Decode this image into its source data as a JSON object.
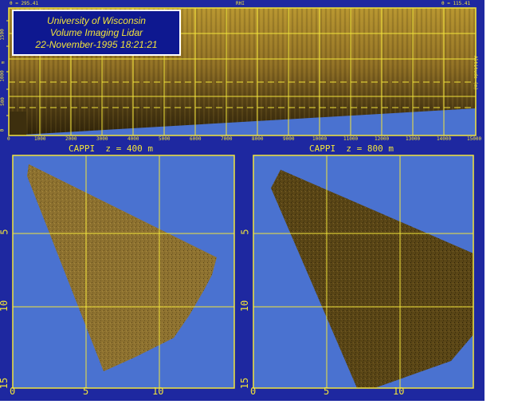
{
  "colors": {
    "frame": "#1e28a0",
    "sky": "#4a72d0",
    "grid": "#f2e43a",
    "lidar": "#8a6a22",
    "title_box": "#0e1890",
    "title_text": "#f2e43a"
  },
  "rhi": {
    "top_left": "θ = 295.41",
    "top_center": "RHI",
    "top_right": "θ = 115.41",
    "y_ticks": [
      "0",
      "500",
      "1000",
      "1500"
    ],
    "y_unit": "m",
    "right_label": "Altitude (m)",
    "x_ticks": [
      "0",
      "1000",
      "2000",
      "3000",
      "4000",
      "5000",
      "6000",
      "7000",
      "8000",
      "9000",
      "10000",
      "11000",
      "12000",
      "13000",
      "14000",
      "15000"
    ]
  },
  "title_box": {
    "line1": "University of Wisconsin",
    "line2": "Volume Imaging Lidar",
    "line3": "22-November-1995 18:21:21"
  },
  "cappi_left": {
    "title": "CAPPI  z = 400 m",
    "y_ticks": [
      "5",
      "10",
      "15"
    ],
    "x_ticks": [
      "0",
      "5",
      "10"
    ]
  },
  "cappi_right": {
    "title": "CAPPI  z = 800 m",
    "y_ticks": [
      "5",
      "10",
      "15"
    ],
    "x_ticks": [
      "0",
      "5",
      "10"
    ]
  }
}
